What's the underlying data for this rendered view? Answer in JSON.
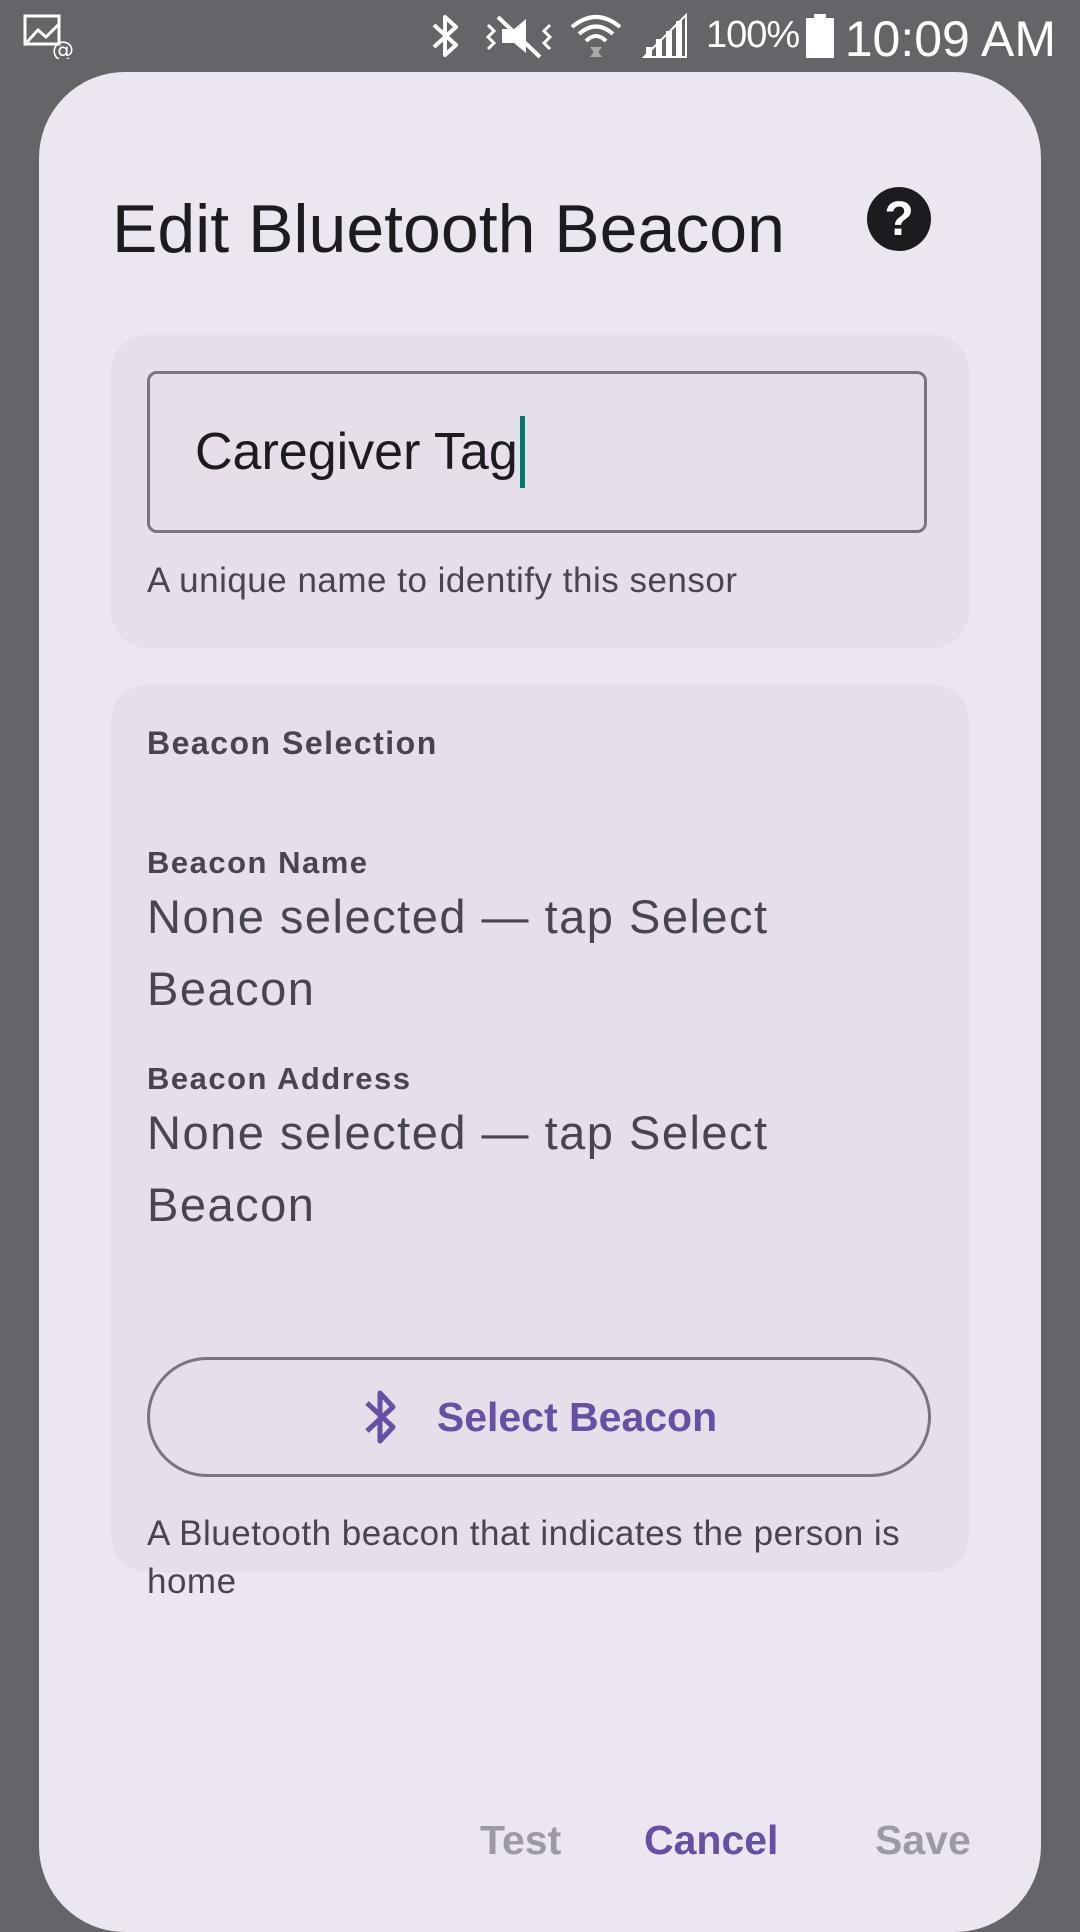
{
  "status_bar": {
    "icons": [
      "image-notification-icon",
      "bluetooth-icon",
      "vibrate-mute-icon",
      "wifi-icon",
      "signal-icon",
      "battery-icon"
    ],
    "battery": "100%",
    "time": "10:09 AM"
  },
  "dialog": {
    "title": "Edit Bluetooth Beacon",
    "help_icon": "help-circle-icon",
    "name_field": {
      "value": "Caregiver Tag",
      "helper": "A unique name to identify this sensor"
    },
    "beacon_section": {
      "title": "Beacon Selection",
      "name_label": "Beacon Name",
      "name_value": "None selected — tap Select Beacon",
      "address_label": "Beacon Address",
      "address_value": "None selected — tap Select Beacon",
      "select_button": "Select Beacon",
      "select_icon": "bluetooth-icon",
      "helper": "A Bluetooth beacon that indicates the person is home"
    },
    "actions": {
      "test": "Test",
      "cancel": "Cancel",
      "save": "Save"
    }
  },
  "colors": {
    "scrim": "#666468",
    "dialog_bg": "#ece6f0",
    "card_bg": "#e6dfea",
    "primary": "#6750a4",
    "disabled": "#9e9aa3",
    "caret": "#00796b"
  }
}
